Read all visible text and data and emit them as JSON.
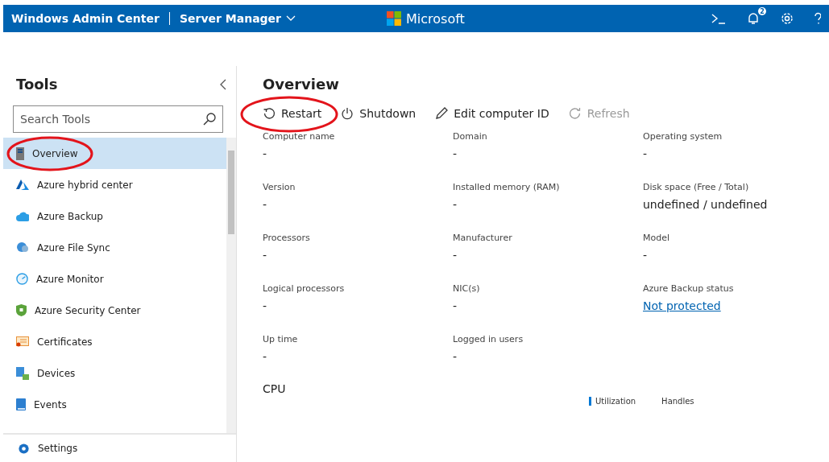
{
  "header": {
    "app_title": "Windows Admin Center",
    "context": "Server Manager",
    "brand": "Microsoft",
    "notification_count": "2"
  },
  "sidebar": {
    "title": "Tools",
    "search": {
      "placeholder": "Search Tools"
    },
    "items": [
      {
        "label": "Overview",
        "selected": true,
        "annotated": true
      },
      {
        "label": "Azure hybrid center",
        "selected": false,
        "annotated": false
      },
      {
        "label": "Azure Backup",
        "selected": false,
        "annotated": false
      },
      {
        "label": "Azure File Sync",
        "selected": false,
        "annotated": false
      },
      {
        "label": "Azure Monitor",
        "selected": false,
        "annotated": false
      },
      {
        "label": "Azure Security Center",
        "selected": false,
        "annotated": false
      },
      {
        "label": "Certificates",
        "selected": false,
        "annotated": false
      },
      {
        "label": "Devices",
        "selected": false,
        "annotated": false
      },
      {
        "label": "Events",
        "selected": false,
        "annotated": false
      }
    ],
    "footer_item": {
      "label": "Settings"
    }
  },
  "main": {
    "title": "Overview",
    "actions": [
      {
        "label": "Restart",
        "disabled": false,
        "annotated": true
      },
      {
        "label": "Shutdown",
        "disabled": false,
        "annotated": false
      },
      {
        "label": "Edit computer ID",
        "disabled": false,
        "annotated": false
      },
      {
        "label": "Refresh",
        "disabled": true,
        "annotated": false
      }
    ],
    "fields": [
      {
        "label": "Computer name",
        "value": "-",
        "kind": "text"
      },
      {
        "label": "Domain",
        "value": "-",
        "kind": "text"
      },
      {
        "label": "Operating system",
        "value": "-",
        "kind": "text"
      },
      {
        "label": "Version",
        "value": "-",
        "kind": "text"
      },
      {
        "label": "Installed memory (RAM)",
        "value": "-",
        "kind": "text"
      },
      {
        "label": "Disk space (Free / Total)",
        "value": "undefined / undefined",
        "kind": "text"
      },
      {
        "label": "Processors",
        "value": "-",
        "kind": "text"
      },
      {
        "label": "Manufacturer",
        "value": "-",
        "kind": "text"
      },
      {
        "label": "Model",
        "value": "-",
        "kind": "text"
      },
      {
        "label": "Logical processors",
        "value": "-",
        "kind": "text"
      },
      {
        "label": "NIC(s)",
        "value": "-",
        "kind": "text"
      },
      {
        "label": "Azure Backup status",
        "value": "Not protected",
        "kind": "link"
      },
      {
        "label": "Up time",
        "value": "-",
        "kind": "text"
      },
      {
        "label": "Logged in users",
        "value": "-",
        "kind": "text"
      }
    ],
    "section_title": "CPU",
    "chart_tabs": [
      {
        "label": "Utilization",
        "selected": true
      },
      {
        "label": "Handles",
        "selected": false
      }
    ]
  }
}
